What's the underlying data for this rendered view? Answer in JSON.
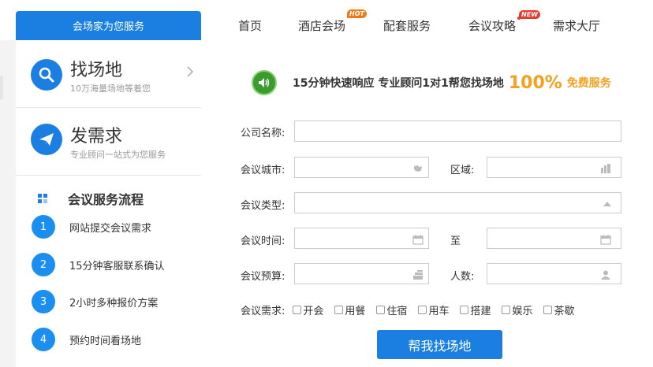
{
  "brand": {
    "tab_label": "会场家为您服务"
  },
  "nav": {
    "items": [
      {
        "label": "首页"
      },
      {
        "label": "酒店会场",
        "badge": "HOT"
      },
      {
        "label": "配套服务"
      },
      {
        "label": "会议攻略",
        "badge": "NEW"
      },
      {
        "label": "需求大厅"
      }
    ]
  },
  "sidebar": {
    "find": {
      "title": "找场地",
      "sub": "10万海量场地等着您",
      "icon": "search-icon"
    },
    "post": {
      "title": "发需求",
      "sub": "专业顾问一站式为您服务",
      "icon": "paper-plane-icon"
    },
    "flow": {
      "title": "会议服务流程",
      "steps": [
        {
          "num": "1",
          "label": "网站提交会议需求"
        },
        {
          "num": "2",
          "label": "15分钟客服联系确认"
        },
        {
          "num": "3",
          "label": "2小时多种报价方案"
        },
        {
          "num": "4",
          "label": "预约时间看场地"
        }
      ]
    }
  },
  "form": {
    "promo": {
      "text": "15分钟快速响应 专业顾问1对1帮您找场地",
      "percent": "100%",
      "free": "免费服务"
    },
    "company_label": "公司名称:",
    "company_value": "",
    "city_label": "会议城市:",
    "city_value": "",
    "area_label": "区域:",
    "area_value": "",
    "type_label": "会议类型:",
    "type_value": "",
    "time_label": "会议时间:",
    "time_from": "",
    "to_label": "至",
    "time_to": "",
    "budget_label": "会议预算:",
    "budget_value": "",
    "people_label": "人数:",
    "people_value": "",
    "needs_label": "会议需求:",
    "needs": [
      {
        "label": "开会",
        "checked": false
      },
      {
        "label": "用餐",
        "checked": false
      },
      {
        "label": "住宿",
        "checked": false
      },
      {
        "label": "用车",
        "checked": false
      },
      {
        "label": "搭建",
        "checked": false
      },
      {
        "label": "娱乐",
        "checked": false
      },
      {
        "label": "茶歇",
        "checked": false
      }
    ],
    "submit_label": "帮我找场地"
  },
  "colors": {
    "accent": "#1a7fe0",
    "promo_orange": "#f5a01e",
    "hot": "#f07a1a",
    "new": "#e83a2e"
  }
}
